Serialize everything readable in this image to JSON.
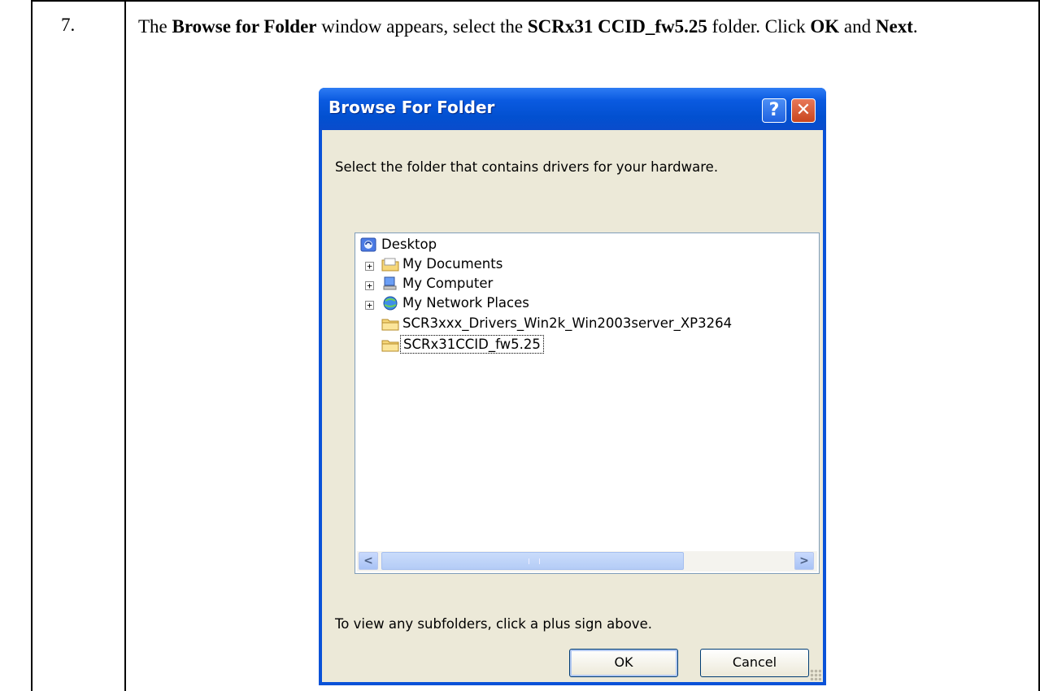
{
  "step": {
    "number": "7.",
    "instruction": {
      "p1": "The ",
      "b1": "Browse for Folder",
      "p2": " window appears, select the ",
      "b2": "SCRx31 CCID_fw5.25",
      "p3": " folder. Click ",
      "b3": "OK",
      "p4": " and ",
      "b4": "Next",
      "p5": "."
    }
  },
  "dialog": {
    "title": "Browse For Folder",
    "help_glyph": "?",
    "close_glyph": "✕",
    "prompt": "Select the folder that contains drivers for your hardware.",
    "tree": [
      {
        "label": "Desktop",
        "icon": "desktop-icon",
        "expander": ""
      },
      {
        "label": "My Documents",
        "icon": "folder-documents-icon",
        "expander": "+"
      },
      {
        "label": "My Computer",
        "icon": "computer-icon",
        "expander": "+"
      },
      {
        "label": "My Network Places",
        "icon": "network-icon",
        "expander": "+"
      },
      {
        "label": "SCR3xxx_Drivers_Win2k_Win2003server_XP3264",
        "icon": "folder-icon",
        "expander": ""
      },
      {
        "label": "SCRx31CCID_fw5.25",
        "icon": "folder-icon",
        "expander": "",
        "selected": true
      }
    ],
    "scroll_left_glyph": "<",
    "scroll_right_glyph": ">",
    "hint": "To view any subfolders, click a plus sign above.",
    "ok_label": "OK",
    "cancel_label": "Cancel"
  }
}
